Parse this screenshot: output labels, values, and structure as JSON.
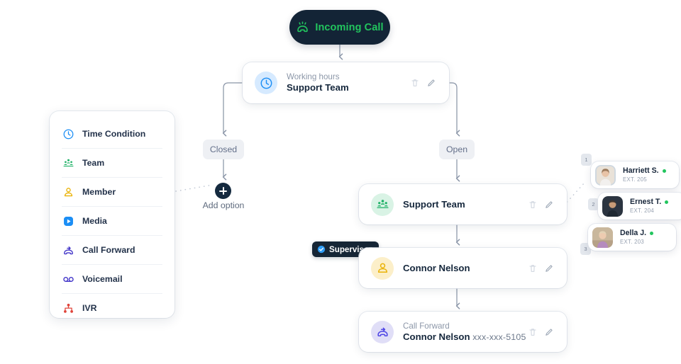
{
  "incoming": {
    "label": "Incoming Call",
    "icon": "incoming-call-icon",
    "bg": "#132436",
    "fg": "#22c55e"
  },
  "nodes": {
    "working_hours": {
      "sub": "Working hours",
      "title": "Support Team",
      "icon": "clock-icon",
      "icon_color": "#1b8ef5",
      "icon_bg": "#d6eaff"
    },
    "support_team": {
      "title": "Support Team",
      "icon": "team-icon",
      "icon_color": "#21b268",
      "icon_bg": "#d9f3e5"
    },
    "connor_nelson": {
      "title": "Connor Nelson",
      "icon": "member-icon",
      "icon_color": "#eab308",
      "icon_bg": "#fcefc9"
    },
    "call_forward": {
      "sub": "Call Forward",
      "title": "Connor Nelson",
      "phone": "xxx-xxx-5105",
      "icon": "call-forward-icon",
      "icon_color": "#4f46e5",
      "icon_bg": "#e0def7"
    }
  },
  "branches": {
    "closed": "Closed",
    "open": "Open"
  },
  "add_option": {
    "label": "Add option",
    "icon": "plus-icon"
  },
  "supervisor_badge": {
    "label": "Supervisor",
    "icon": "check-circle-icon",
    "accent": "#2e9cf5"
  },
  "actions": {
    "delete": "delete-icon",
    "edit": "edit-icon"
  },
  "palette": {
    "items": [
      {
        "label": "Time Condition",
        "icon": "clock-icon",
        "color": "#1b8ef5"
      },
      {
        "label": "Team",
        "icon": "team-icon",
        "color": "#21b268"
      },
      {
        "label": "Member",
        "icon": "member-icon",
        "color": "#eab308"
      },
      {
        "label": "Media",
        "icon": "media-play-icon",
        "color": "#1b8ef5"
      },
      {
        "label": "Call Forward",
        "icon": "call-forward-icon",
        "color": "#4336c9"
      },
      {
        "label": "Voicemail",
        "icon": "voicemail-icon",
        "color": "#4336c9"
      },
      {
        "label": "IVR",
        "icon": "ivr-icon",
        "color": "#e0443a"
      }
    ]
  },
  "members": [
    {
      "order": "1",
      "name": "Harriett S.",
      "ext": "EXT. 205",
      "status": "online"
    },
    {
      "order": "2",
      "name": "Ernest T.",
      "ext": "EXT. 204",
      "status": "online"
    },
    {
      "order": "3",
      "name": "Della J.",
      "ext": "EXT. 203",
      "status": "online"
    }
  ]
}
